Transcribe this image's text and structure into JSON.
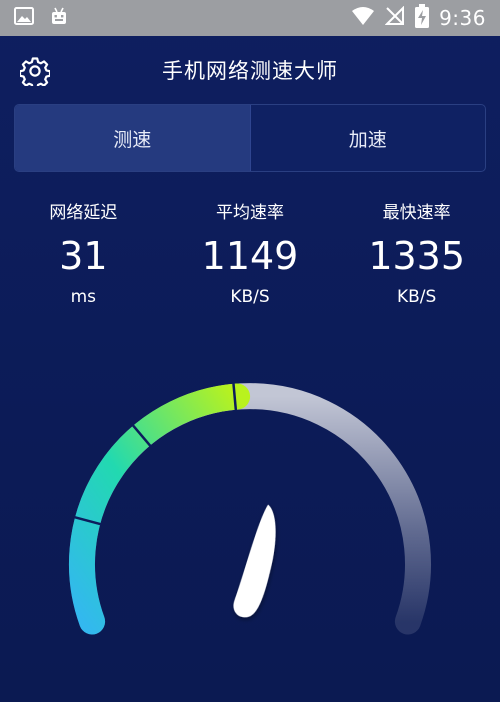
{
  "status_bar": {
    "time": "9:36",
    "left_icons": [
      "image-icon",
      "android-icon"
    ],
    "right_icons": [
      "wifi-icon",
      "no-signal-icon",
      "battery-charging-icon"
    ]
  },
  "header": {
    "title": "手机网络测速大师",
    "settings_icon": "gear-icon"
  },
  "tabs": [
    {
      "label": "测速",
      "active": true
    },
    {
      "label": "加速",
      "active": false
    }
  ],
  "stats": {
    "latency": {
      "label": "网络延迟",
      "value": "31",
      "unit": "ms"
    },
    "avg_speed": {
      "label": "平均速率",
      "value": "1149",
      "unit": "KB/S"
    },
    "max_speed": {
      "label": "最快速率",
      "value": "1335",
      "unit": "KB/S"
    }
  },
  "gauge": {
    "level": 0.48,
    "colors": {
      "low": "#33b8ef",
      "mid": "#22d9b0",
      "high": "#b9f21e",
      "track": "#ffffff",
      "needle": "#ffffff"
    }
  }
}
